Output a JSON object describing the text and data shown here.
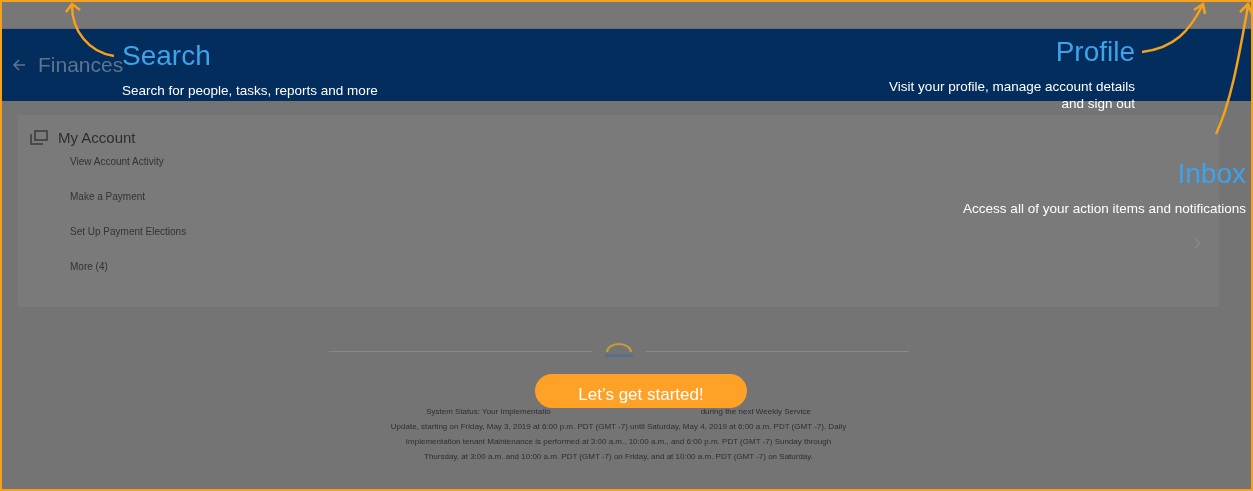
{
  "header": {
    "title": "Finances"
  },
  "card": {
    "title": "My Account",
    "items": [
      "View Account Activity",
      "Make a Payment",
      "Set Up Payment Elections",
      "More (4)"
    ]
  },
  "footer": {
    "status_lines": [
      [
        "System Status: Your Implementatio",
        "during the next Weekly Service"
      ],
      [
        "Update, starting on Friday, May 3, 2019 at 6:00 p.m. PDT (GMT -7) until Saturday, May 4, 2019 at 6:00 a.m. PDT (GMT -7). Daily"
      ],
      [
        "Implementation tenant Maintenance is performed at 3:00 a.m., 10:00 a.m., and 6:00 p.m. PDT (GMT -7) Sunday through"
      ],
      [
        "Thursday, at 3:00 a.m. and 10:00 a.m. PDT (GMT -7) on Friday, and at 10:00 a.m. PDT (GMT -7) on Saturday."
      ]
    ]
  },
  "tour": {
    "tips": [
      {
        "kind": "search",
        "title": "Search",
        "text": "Search for people, tasks, reports and more"
      },
      {
        "kind": "profile",
        "title": "Profile",
        "text": "Visit your profile, manage account details and sign out"
      },
      {
        "kind": "inbox",
        "title": "Inbox",
        "text": "Access all of your action items and notifications"
      }
    ],
    "button": "Let’s get started!"
  }
}
